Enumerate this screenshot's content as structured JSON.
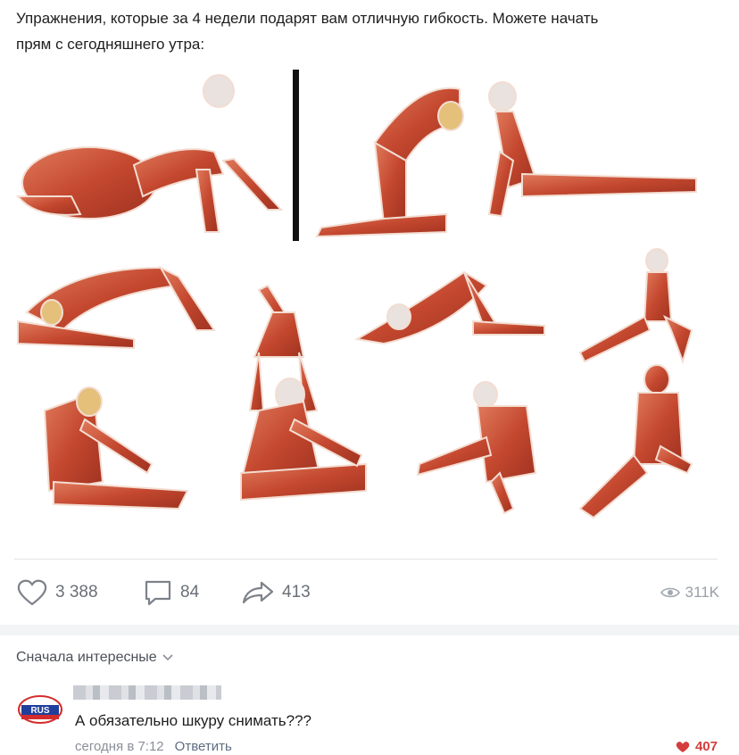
{
  "post": {
    "text_line1": "Упражнения, которые за 4 недели подарят вам отличную гибкость. Можете начать",
    "text_line2": "прям с сегодняшнего утра:"
  },
  "actions": {
    "likes": "3 388",
    "comments": "84",
    "shares": "413",
    "views": "311K"
  },
  "comments_section": {
    "sort_label": "Сначала интересные",
    "comment": {
      "avatar_label": "RUS",
      "text": "А обязательно шкуру снимать???",
      "time": "сегодня в 7:12",
      "reply_label": "Ответить",
      "like_count": "407"
    }
  },
  "colors": {
    "muscle": "#c9543a",
    "tendon": "#f2dccf",
    "accent_like": "#d43d3d"
  }
}
